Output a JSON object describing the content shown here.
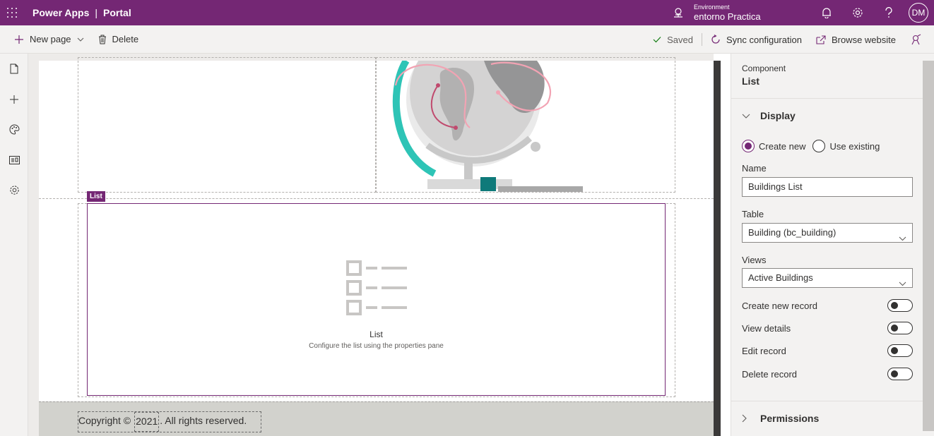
{
  "header": {
    "app_name": "Power Apps",
    "separator": "|",
    "section": "Portal",
    "environment_label": "Environment",
    "environment_name": "entorno Practica",
    "avatar_initials": "DM"
  },
  "commands": {
    "new_page": "New page",
    "delete": "Delete",
    "saved": "Saved",
    "sync": "Sync configuration",
    "browse": "Browse website"
  },
  "canvas": {
    "list_tag": "List",
    "placeholder_title": "List",
    "placeholder_desc": "Configure the list using the properties pane",
    "copyright_prefix": "Copyright ©",
    "copyright_year": "2021",
    "copyright_suffix": ". All rights reserved."
  },
  "pane": {
    "component_label": "Component",
    "component_name": "List",
    "display_section": "Display",
    "radio_create_new": "Create new",
    "radio_use_existing": "Use existing",
    "name_label": "Name",
    "name_value": "Buildings List",
    "table_label": "Table",
    "table_value": "Building (bc_building)",
    "views_label": "Views",
    "views_value": "Active Buildings",
    "toggles": {
      "create_new_record": "Create new record",
      "view_details": "View details",
      "edit_record": "Edit record",
      "delete_record": "Delete record"
    },
    "permissions_section": "Permissions"
  },
  "colors": {
    "brand": "#742774",
    "teal": "#2ec4b6",
    "saved_check": "#107c10"
  }
}
